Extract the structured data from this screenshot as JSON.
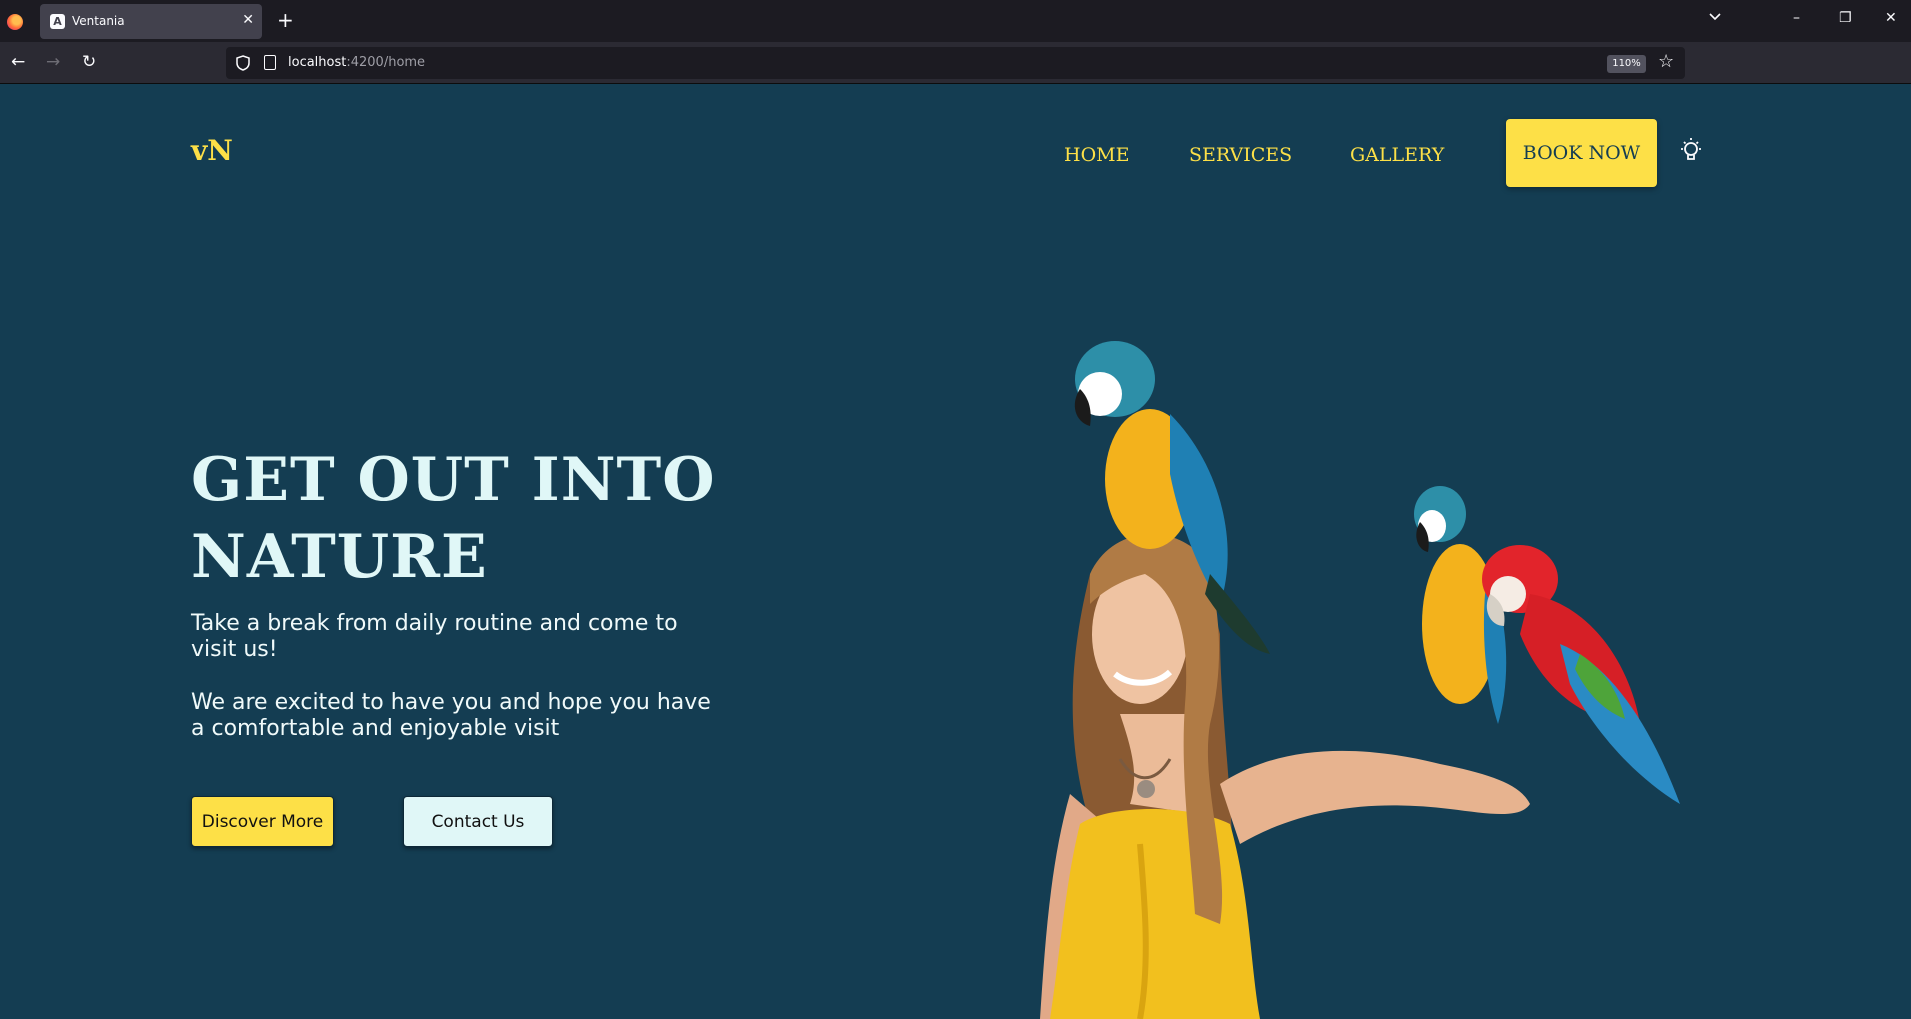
{
  "browser": {
    "tab_title": "Ventania",
    "tab_icon_letter": "A",
    "url_host": "localhost",
    "url_path": ":4200/home",
    "zoom": "110%"
  },
  "site": {
    "logo": "vN",
    "nav": [
      "HOME",
      "SERVICES",
      "GALLERY"
    ],
    "book_now": "BOOK NOW",
    "hero": {
      "title_line1": "GET OUT INTO",
      "title_line2": "NATURE",
      "paragraph1": "Take a break from daily routine and come to visit us!",
      "paragraph2": "We are excited to have you and hope you have a comfortable and enjoyable visit",
      "discover_button": "Discover More",
      "contact_button": "Contact Us"
    }
  },
  "colors": {
    "page_bg": "#143d52",
    "accent": "#fde047",
    "light": "#e0f7f7"
  }
}
